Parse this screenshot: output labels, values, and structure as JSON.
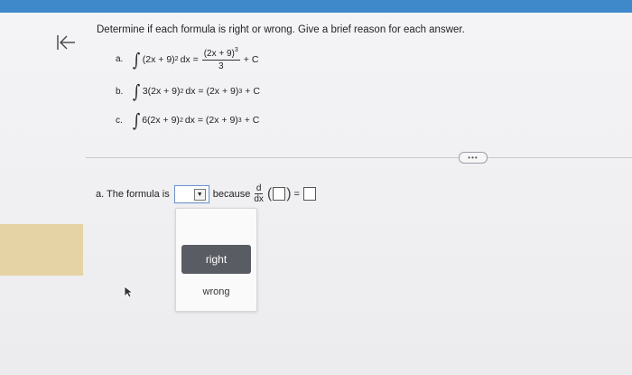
{
  "question": {
    "prompt": "Determine if each formula is right or wrong. Give a brief reason for each answer.",
    "items": [
      {
        "label": "a.",
        "integrand": "(2x + 9)",
        "exp": "2",
        "dx": "dx =",
        "frac_num": "(2x + 9)",
        "frac_num_exp": "3",
        "frac_den": "3",
        "tail": "+ C"
      },
      {
        "label": "b.",
        "integrand": "3(2x + 9)",
        "exp": "2",
        "dx": "dx = (2x + 9)",
        "rhs_exp": "3",
        "tail": "+ C"
      },
      {
        "label": "c.",
        "integrand": "6(2x + 9)",
        "exp": "2",
        "dx": "dx = (2x + 9)",
        "rhs_exp": "3",
        "tail": "+ C"
      }
    ]
  },
  "answer": {
    "prefix": "a. The formula is",
    "because": "because",
    "d_num": "d",
    "d_den": "dx",
    "equals": "="
  },
  "dropdown": {
    "options": [
      "right",
      "wrong"
    ],
    "selected": ""
  },
  "colors": {
    "top_bar": "#3f88c9",
    "highlight_strip": "#e5d3a6",
    "selected_option": "#595c62"
  }
}
